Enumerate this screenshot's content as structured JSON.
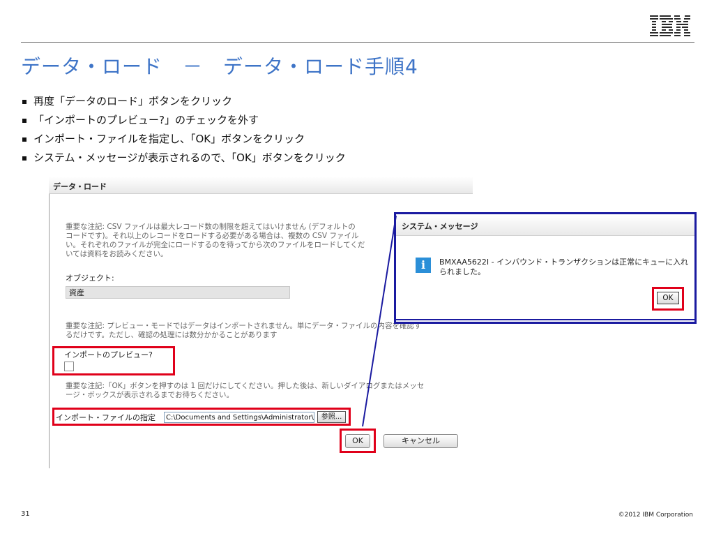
{
  "logo": {
    "icon": "ibm-logo"
  },
  "title": "データ・ロード　－　データ・ロード手順4",
  "bullets": [
    "再度「データのロード」ボタンをクリック",
    "「インポートのプレビュー?」のチェックを外す",
    "インポート・ファイルを指定し、「OK」ボタンをクリック",
    "システム・メッセージが表示されるので、「OK」ボタンをクリック"
  ],
  "screenshot": {
    "header_title": "データ・ロード",
    "note1": [
      "重要な注記: CSV ファイルは最大レコード数の制限を超えてはいけません (デフォルトの",
      "コードです)。それ以上のレコードをロードする必要がある場合は、複数の CSV ファイル",
      "い。それぞれのファイルが完全にロードするのを待ってから次のファイルをロードしてくだ",
      "いては資料をお読みください。"
    ],
    "object_label": "オブジェクト:",
    "object_value": "資産",
    "note2": [
      "重要な注記: プレビュー・モードではデータはインポートされません。単にデータ・ファイルの内容を確認す",
      "るだけです。ただし、確認の処理には数分かかることがあります"
    ],
    "preview_label": "インポートのプレビュー?",
    "note3": [
      "重要な注記:「OK」ボタンを押すのは 1 回だけにしてください。押した後は、新しいダイアログまたはメッセ",
      "ージ・ボックスが表示されるまでお待ちください。"
    ],
    "file_label": "インポート・ファイルの指定",
    "file_value": "C:\\Documents and Settings\\Administrator\\",
    "browse_label": "参照...",
    "ok_label": "OK",
    "cancel_label": "キャンセル"
  },
  "dialog": {
    "title": "システム・メッセージ",
    "message": "BMXAA5622I - インバウンド・トランザクションは正常にキューに入れられました。",
    "ok_label": "OK",
    "icon": "info-icon"
  },
  "footer": {
    "page_number": "31",
    "copyright": "©2012 IBM Corporation"
  },
  "colors": {
    "title": "#3e74c7",
    "highlight": "#e0001a",
    "dialog_border": "#1a1aa0"
  }
}
